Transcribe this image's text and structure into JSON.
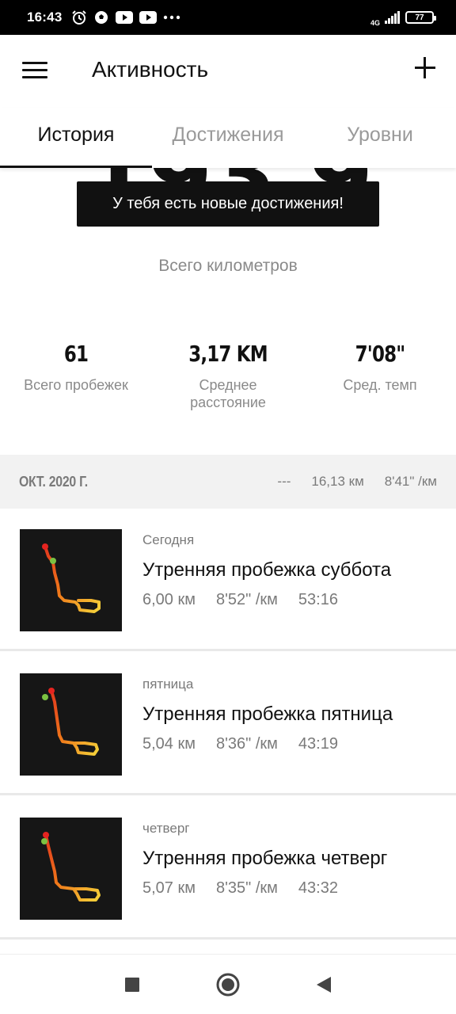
{
  "status_bar": {
    "time": "16:43",
    "network": "4G",
    "battery": "77",
    "icons": [
      "alarm-icon",
      "soccer-ball-icon",
      "youtube-icon",
      "youtube-icon",
      "more-dots-icon"
    ]
  },
  "app_bar": {
    "title": "Активность",
    "menu_icon": "hamburger-menu-icon",
    "add_icon": "plus-icon"
  },
  "tabs": [
    {
      "label": "История",
      "active": true
    },
    {
      "label": "Достижения",
      "active": false
    },
    {
      "label": "Уровни",
      "active": false
    }
  ],
  "toast": "У тебя есть новые достижения!",
  "summary": {
    "total_km_partial": "193,9",
    "total_label": "Всего километров",
    "stats": [
      {
        "value": "61",
        "label": "Всего пробежек"
      },
      {
        "value": "3,17 KM",
        "label": "Среднее расстояние"
      },
      {
        "value": "7'08\"",
        "label": "Сред. темп"
      }
    ]
  },
  "month": {
    "title": "ОКТ. 2020 Г.",
    "runs": "---",
    "distance": "16,13 км",
    "pace": "8'41\" /км"
  },
  "runs": [
    {
      "day": "Сегодня",
      "title": "Утренняя пробежка суббота",
      "distance": "6,00 км",
      "pace": "8'52\" /км",
      "duration": "53:16"
    },
    {
      "day": "пятница",
      "title": "Утренняя пробежка пятница",
      "distance": "5,04 км",
      "pace": "8'36\" /км",
      "duration": "43:19"
    },
    {
      "day": "четверг",
      "title": "Утренняя пробежка четверг",
      "distance": "5,07 км",
      "pace": "8'35\" /км",
      "duration": "43:32"
    }
  ],
  "colors": {
    "accent": "#111111",
    "muted": "#8a8a8a",
    "route_start": "#e52420",
    "route_end": "#7cc242",
    "route_path": "#f07a1a"
  },
  "nav_bar": {
    "icons": [
      "recent-apps-square-icon",
      "home-circle-icon",
      "back-triangle-icon"
    ]
  }
}
